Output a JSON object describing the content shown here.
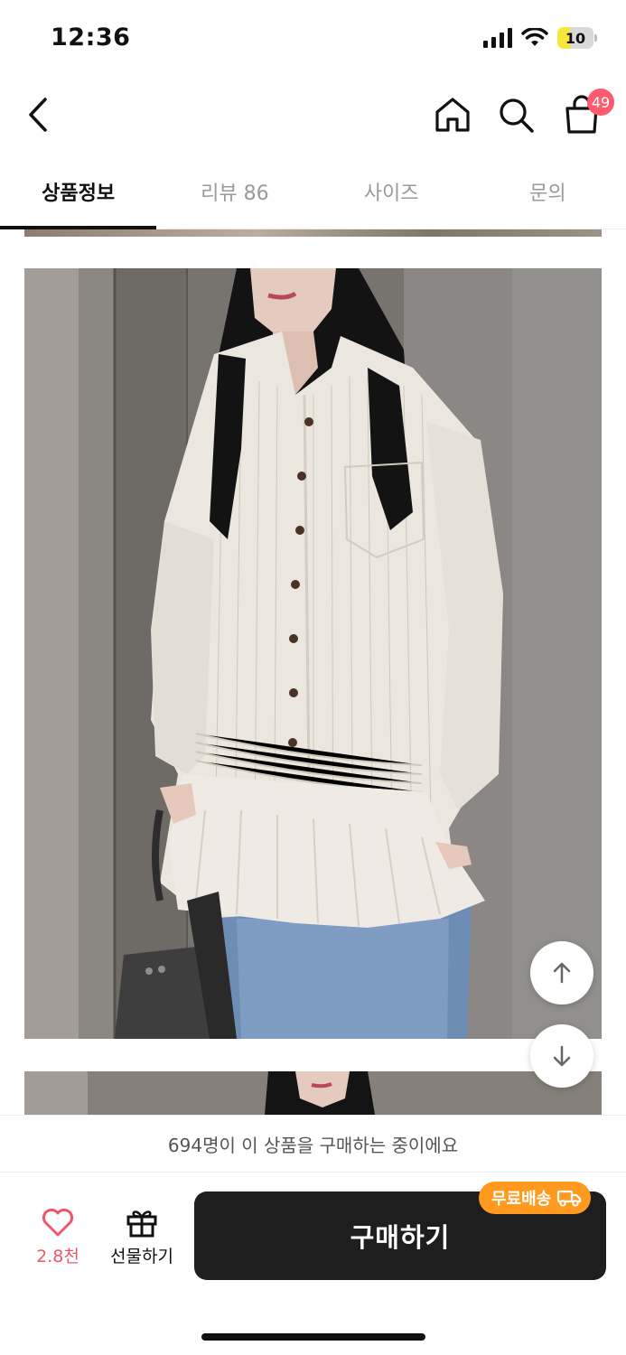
{
  "status": {
    "time": "12:36",
    "battery": "10"
  },
  "header": {
    "cart_count": "49"
  },
  "tabs": [
    {
      "label": "상품정보",
      "active": true
    },
    {
      "label": "리뷰 86",
      "active": false
    },
    {
      "label": "사이즈",
      "active": false
    },
    {
      "label": "문의",
      "active": false
    }
  ],
  "notice": {
    "text": "694명이 이 상품을 구매하는 중이에요"
  },
  "bottom": {
    "like_count": "2.8천",
    "gift_label": "선물하기",
    "buy_label": "구매하기",
    "shipping_badge": "무료배송"
  },
  "colors": {
    "accent_pink": "#f0566a",
    "badge_orange": "#ff9a1f",
    "buy_button": "#1e1e1e"
  },
  "icons": [
    "back-icon",
    "home-icon",
    "search-icon",
    "shopping-bag-icon",
    "heart-icon",
    "gift-icon",
    "arrow-up-icon",
    "arrow-down-icon",
    "truck-icon"
  ]
}
